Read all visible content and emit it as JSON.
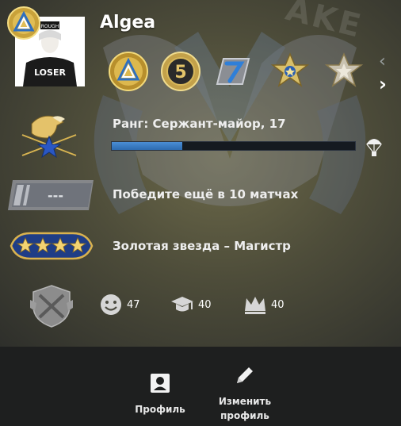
{
  "profile": {
    "name": "Algea",
    "avatar_caption": "LOSER",
    "avatar_hat_text": "ROUGH"
  },
  "background": {
    "watermark_text": "AKE"
  },
  "medals": [
    {
      "name": "gold-triangle-coin-icon"
    },
    {
      "name": "five-year-coin-icon"
    },
    {
      "name": "blue-seven-pin-icon"
    },
    {
      "name": "gold-star-medal-icon"
    },
    {
      "name": "silver-star-medal-icon"
    }
  ],
  "rank": {
    "text": "Ранг: Сержант-майор, 17",
    "progress": 0.29
  },
  "wins": {
    "text": "Победите ещё в 10 матчах",
    "placeholder": "---"
  },
  "skill": {
    "text": "Золотая звезда – Магистр"
  },
  "commendations": {
    "friendly": "47",
    "teacher": "40",
    "leader": "40"
  },
  "footer": {
    "profile_label": "Профиль",
    "edit_label_line1": "Изменить",
    "edit_label_line2": "профиль"
  },
  "colors": {
    "xp_fill": "#3a7fd0",
    "panel_bg": "#4e4d3a",
    "footer_bg": "#1e1f1f"
  }
}
